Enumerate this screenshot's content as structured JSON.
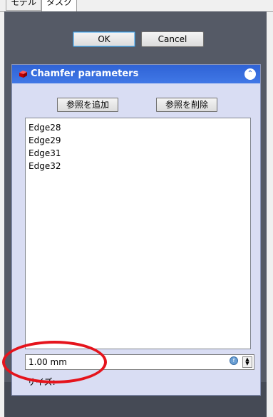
{
  "tabs": [
    {
      "label": "モデル"
    },
    {
      "label": "タスク"
    }
  ],
  "dialog": {
    "ok_label": "OK",
    "cancel_label": "Cancel"
  },
  "parameters": {
    "title": "Chamfer parameters",
    "add_ref_label": "参照を追加",
    "remove_ref_label": "参照を削除",
    "edges": [
      "Edge28",
      "Edge29",
      "Edge31",
      "Edge32"
    ],
    "size_value": "1.00 mm",
    "size_label": "サイズ:"
  },
  "colors": {
    "panel_bg": "#555a66",
    "header_blue": "#3a6fe0",
    "group_bg": "#d9ddf3",
    "annotation_red": "#e5141c"
  },
  "icons": {
    "header": "chamfer-cube-icon",
    "collapse": "collapse-chevrons-icon",
    "expression": "expression-icon",
    "spin": "spin-arrows-icon"
  }
}
